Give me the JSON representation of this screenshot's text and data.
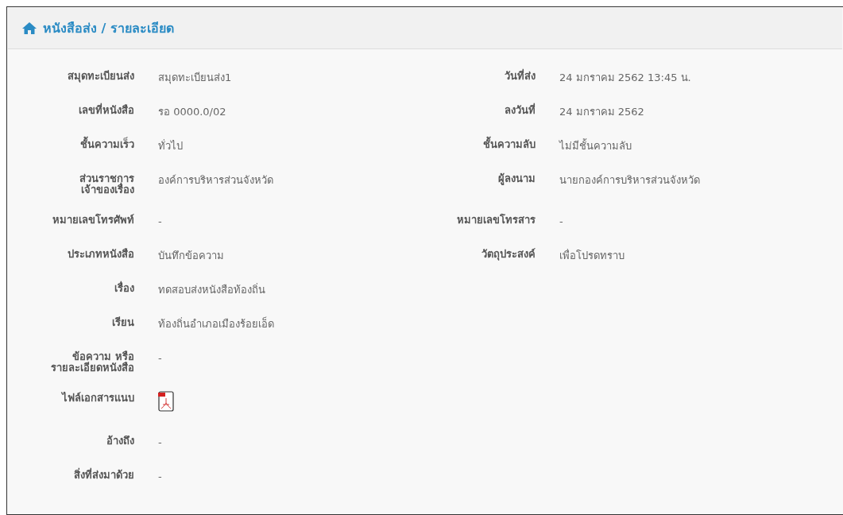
{
  "header": {
    "title": "หนังสือส่ง / รายละเอียด"
  },
  "rows": [
    {
      "left": {
        "label": "สมุดทะเบียนส่ง",
        "value": "สมุดทะเบียนส่ง1"
      },
      "right": {
        "label": "วันที่ส่ง",
        "value": "24 มกราคม 2562 13:45 น."
      }
    },
    {
      "left": {
        "label": "เลขที่หนังสือ",
        "value": "รอ 0000.0/02"
      },
      "right": {
        "label": "ลงวันที่",
        "value": "24 มกราคม 2562"
      }
    },
    {
      "left": {
        "label": "ชั้นความเร็ว",
        "value": "ทั่วไป"
      },
      "right": {
        "label": "ชั้นความลับ",
        "value": "ไม่มีชั้นความลับ"
      }
    },
    {
      "left": {
        "label": "ส่วนราชการ\nเจ้าของเรื่อง",
        "value": "องค์การบริหารส่วนจังหวัด"
      },
      "right": {
        "label": "ผู้ลงนาม",
        "value": "นายกองค์การบริหารส่วนจังหวัด"
      }
    },
    {
      "left": {
        "label": "หมายเลขโทรศัพท์",
        "value": "-"
      },
      "right": {
        "label": "หมายเลขโทรสาร",
        "value": "-"
      }
    },
    {
      "left": {
        "label": "ประเภทหนังสือ",
        "value": "บันทึกข้อความ"
      },
      "right": {
        "label": "วัตถุประสงค์",
        "value": "เพื่อโปรดทราบ"
      }
    },
    {
      "left": {
        "label": "เรื่อง",
        "value": "ทดสอบส่งหนังสือท้องถิ่น"
      }
    },
    {
      "left": {
        "label": "เรียน",
        "value": "ท้องถิ่นอำเภอเมืองร้อยเอ็ด"
      }
    },
    {
      "left": {
        "label": "ข้อความ หรือ\nรายละเอียดหนังสือ",
        "value": "-"
      }
    },
    {
      "left": {
        "label": "ไฟล์เอกสารแนบ",
        "kind": "file"
      }
    },
    {
      "left": {
        "label": "อ้างถึง",
        "value": "-"
      }
    },
    {
      "left": {
        "label": "สิ่งที่ส่งมาด้วย",
        "value": "-"
      }
    }
  ]
}
